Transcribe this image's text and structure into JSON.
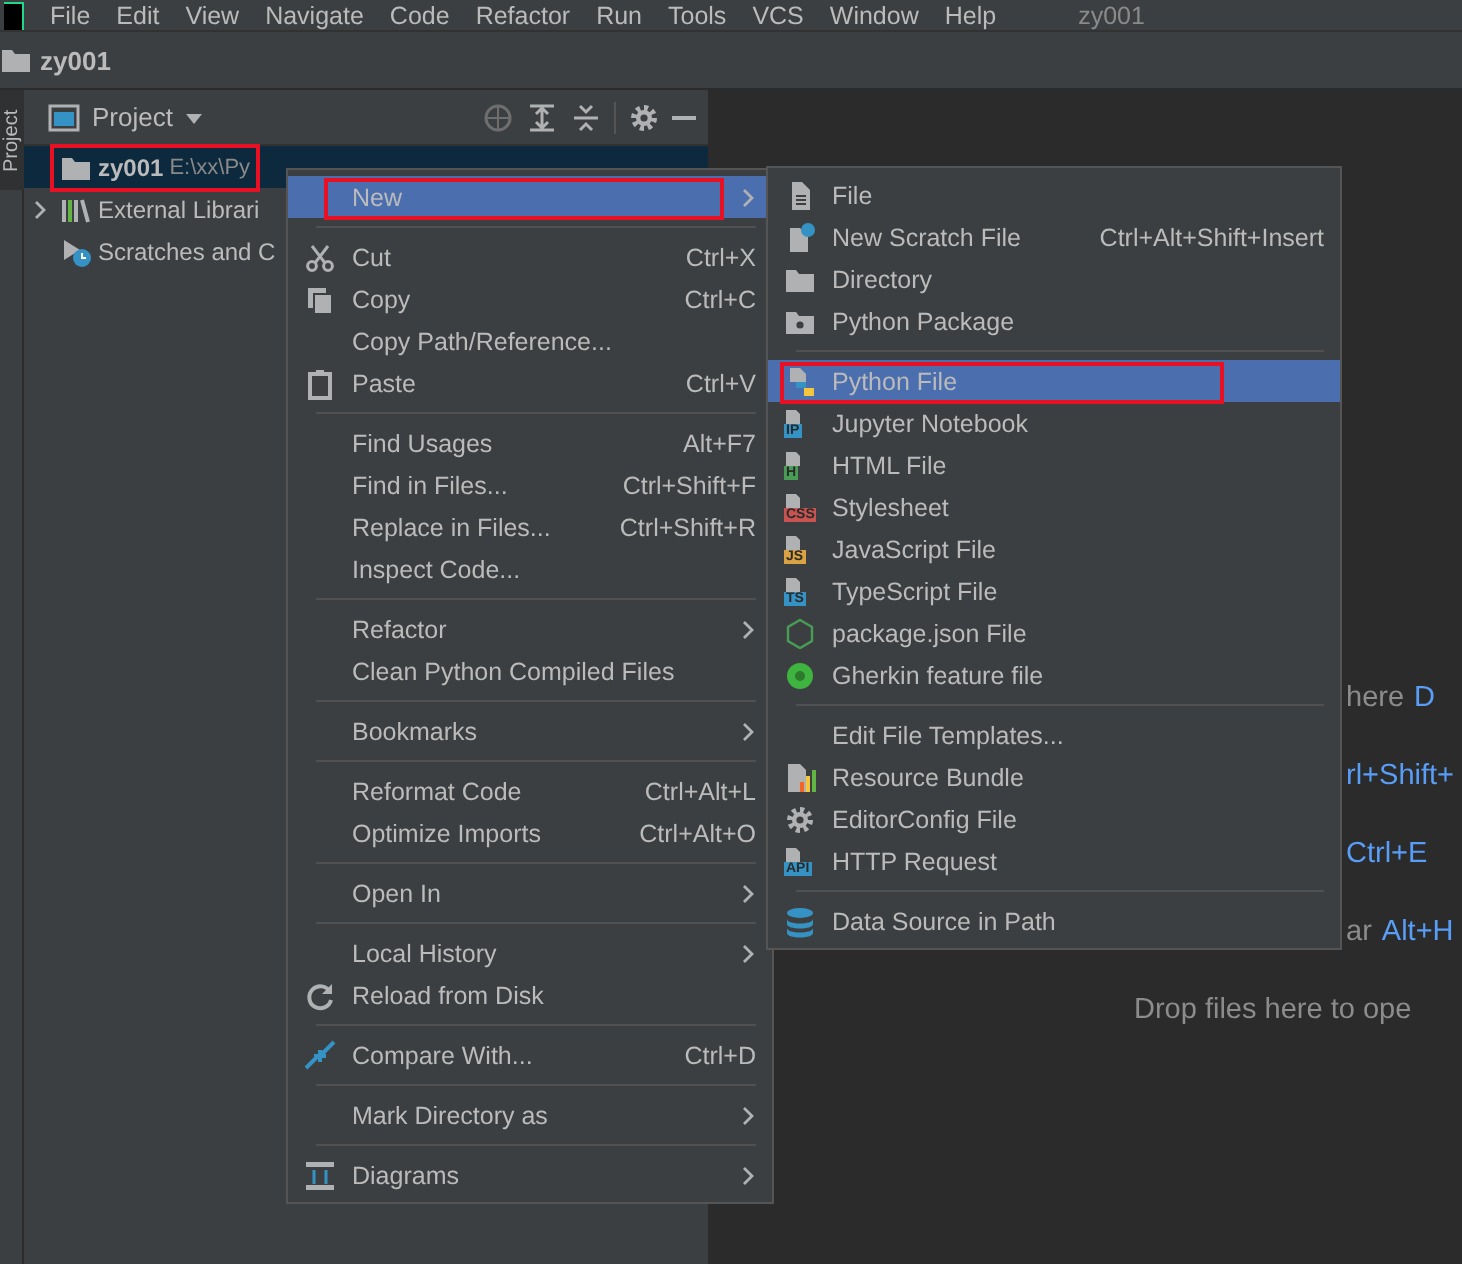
{
  "menubar": {
    "items": [
      "File",
      "Edit",
      "View",
      "Navigate",
      "Code",
      "Refactor",
      "Run",
      "Tools",
      "VCS",
      "Window",
      "Help"
    ],
    "title": "zy001"
  },
  "breadcrumb": {
    "label": "zy001"
  },
  "side_strip": {
    "label": "Project"
  },
  "project_panel": {
    "title": "Project",
    "rows": [
      {
        "kind": "folder",
        "label": "zy001",
        "path": "E:\\xx\\Py",
        "selected": true,
        "annotated": true,
        "expandable": false
      },
      {
        "kind": "library",
        "label": "External Librari",
        "selected": false,
        "annotated": false,
        "expandable": true
      },
      {
        "kind": "scratches",
        "label": "Scratches and C",
        "selected": false,
        "annotated": false,
        "expandable": false
      }
    ]
  },
  "editor_hints": [
    {
      "text": "here",
      "key": "D"
    },
    {
      "key": "rl+Shift+"
    },
    {
      "key": "Ctrl+E"
    },
    {
      "text": "ar",
      "key": "Alt+H"
    },
    {
      "text": "Drop files here to ope"
    }
  ],
  "context_menu": {
    "items": [
      {
        "kind": "plain",
        "label": "New",
        "submenu": true,
        "selected": true,
        "annotated": true
      },
      {
        "kind": "separator"
      },
      {
        "kind": "scissors",
        "label": "Cut",
        "shortcut": "Ctrl+X",
        "submenu": false,
        "selected": false,
        "annotated": false
      },
      {
        "kind": "copy",
        "label": "Copy",
        "shortcut": "Ctrl+C",
        "submenu": false,
        "selected": false,
        "annotated": false
      },
      {
        "kind": "plain",
        "label": "Copy Path/Reference...",
        "submenu": false,
        "selected": false,
        "annotated": false
      },
      {
        "kind": "clipboard",
        "label": "Paste",
        "shortcut": "Ctrl+V",
        "submenu": false,
        "selected": false,
        "annotated": false
      },
      {
        "kind": "separator"
      },
      {
        "kind": "plain",
        "label": "Find Usages",
        "shortcut": "Alt+F7",
        "submenu": false,
        "selected": false,
        "annotated": false
      },
      {
        "kind": "plain",
        "label": "Find in Files...",
        "shortcut": "Ctrl+Shift+F",
        "submenu": false,
        "selected": false,
        "annotated": false
      },
      {
        "kind": "plain",
        "label": "Replace in Files...",
        "shortcut": "Ctrl+Shift+R",
        "submenu": false,
        "selected": false,
        "annotated": false
      },
      {
        "kind": "plain",
        "label": "Inspect Code...",
        "submenu": false,
        "selected": false,
        "annotated": false
      },
      {
        "kind": "separator"
      },
      {
        "kind": "plain",
        "label": "Refactor",
        "submenu": true,
        "selected": false,
        "annotated": false
      },
      {
        "kind": "plain",
        "label": "Clean Python Compiled Files",
        "submenu": false,
        "selected": false,
        "annotated": false
      },
      {
        "kind": "separator"
      },
      {
        "kind": "plain",
        "label": "Bookmarks",
        "submenu": true,
        "selected": false,
        "annotated": false
      },
      {
        "kind": "separator"
      },
      {
        "kind": "plain",
        "label": "Reformat Code",
        "shortcut": "Ctrl+Alt+L",
        "submenu": false,
        "selected": false,
        "annotated": false
      },
      {
        "kind": "plain",
        "label": "Optimize Imports",
        "shortcut": "Ctrl+Alt+O",
        "submenu": false,
        "selected": false,
        "annotated": false
      },
      {
        "kind": "separator"
      },
      {
        "kind": "plain",
        "label": "Open In",
        "submenu": true,
        "selected": false,
        "annotated": false
      },
      {
        "kind": "separator"
      },
      {
        "kind": "plain",
        "label": "Local History",
        "submenu": true,
        "selected": false,
        "annotated": false
      },
      {
        "kind": "reload",
        "label": "Reload from Disk",
        "submenu": false,
        "selected": false,
        "annotated": false
      },
      {
        "kind": "separator"
      },
      {
        "kind": "compare",
        "label": "Compare With...",
        "shortcut": "Ctrl+D",
        "submenu": false,
        "selected": false,
        "annotated": false
      },
      {
        "kind": "separator"
      },
      {
        "kind": "plain",
        "label": "Mark Directory as",
        "submenu": true,
        "selected": false,
        "annotated": false
      },
      {
        "kind": "separator"
      },
      {
        "kind": "diagram",
        "label": "Diagrams",
        "submenu": true,
        "selected": false,
        "annotated": false
      }
    ]
  },
  "new_submenu": {
    "items": [
      {
        "kind": "file",
        "label": "File",
        "selected": false,
        "annotated": false
      },
      {
        "kind": "scratch",
        "label": "New Scratch File",
        "shortcut": "Ctrl+Alt+Shift+Insert",
        "selected": false,
        "annotated": false
      },
      {
        "kind": "folder",
        "label": "Directory",
        "selected": false,
        "annotated": false
      },
      {
        "kind": "package",
        "label": "Python Package",
        "selected": false,
        "annotated": false
      },
      {
        "kind": "separator"
      },
      {
        "kind": "python",
        "label": "Python File",
        "selected": true,
        "annotated": true
      },
      {
        "kind": "badge",
        "badge": "IP",
        "color": "#3592c4",
        "label": "Jupyter Notebook",
        "selected": false,
        "annotated": false
      },
      {
        "kind": "badge",
        "badge": "H",
        "color": "#499c54",
        "label": "HTML File",
        "selected": false,
        "annotated": false
      },
      {
        "kind": "badge",
        "badge": "CSS",
        "color": "#c75450",
        "label": "Stylesheet",
        "selected": false,
        "annotated": false
      },
      {
        "kind": "badge",
        "badge": "JS",
        "color": "#d9a343",
        "label": "JavaScript File",
        "selected": false,
        "annotated": false
      },
      {
        "kind": "badge",
        "badge": "TS",
        "color": "#3592c4",
        "label": "TypeScript File",
        "selected": false,
        "annotated": false
      },
      {
        "kind": "nodejs",
        "label": "package.json File",
        "selected": false,
        "annotated": false
      },
      {
        "kind": "gherkin",
        "label": "Gherkin feature file",
        "selected": false,
        "annotated": false
      },
      {
        "kind": "separator"
      },
      {
        "kind": "plain",
        "label": "Edit File Templates...",
        "selected": false,
        "annotated": false
      },
      {
        "kind": "bundle",
        "label": "Resource Bundle",
        "selected": false,
        "annotated": false
      },
      {
        "kind": "gear",
        "label": "EditorConfig File",
        "selected": false,
        "annotated": false
      },
      {
        "kind": "badge",
        "badge": "API",
        "color": "#3592c4",
        "label": "HTTP Request",
        "selected": false,
        "annotated": false
      },
      {
        "kind": "separator"
      },
      {
        "kind": "database",
        "label": "Data Source in Path",
        "selected": false,
        "annotated": false
      }
    ]
  }
}
